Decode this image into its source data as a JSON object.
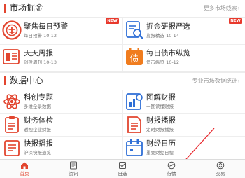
{
  "market": {
    "title": "市场掘金",
    "more": "更多市场线索",
    "items": [
      {
        "name": "聚焦每日预警",
        "sub": "每日预警 10-12",
        "badge": "NEW"
      },
      {
        "name": "掘金研报严选",
        "sub": "靠报精选 10-14",
        "badge": "NEW"
      },
      {
        "name": "天天周报",
        "sub": "创投周刊 10-13",
        "badge": ""
      },
      {
        "name": "每日债市纵览",
        "sub": "债市纵览 10-12",
        "badge": ""
      }
    ]
  },
  "data_center": {
    "title": "数据中心",
    "more": "专业市场数据统计",
    "items": [
      {
        "name": "科创专题",
        "sub": "多维全景数据"
      },
      {
        "name": "图解财报",
        "sub": "一图读懂财报"
      },
      {
        "name": "财务体检",
        "sub": "透视企业财报"
      },
      {
        "name": "财报播报",
        "sub": "定时财报播报"
      },
      {
        "name": "快报播报",
        "sub": "沪深快报速览"
      },
      {
        "name": "财经日历",
        "sub": "重要财经日程"
      }
    ]
  },
  "tabbar": {
    "items": [
      {
        "label": "首页",
        "icon": "home-icon"
      },
      {
        "label": "资讯",
        "icon": "news-icon"
      },
      {
        "label": "自选",
        "icon": "checkbox-icon"
      },
      {
        "label": "行情",
        "icon": "market-gauge-icon"
      },
      {
        "label": "交易",
        "icon": "trade-icon"
      }
    ]
  },
  "colors": {
    "accent": "#e2452f",
    "blue": "#2f6fd6",
    "orange": "#f07c1e"
  }
}
